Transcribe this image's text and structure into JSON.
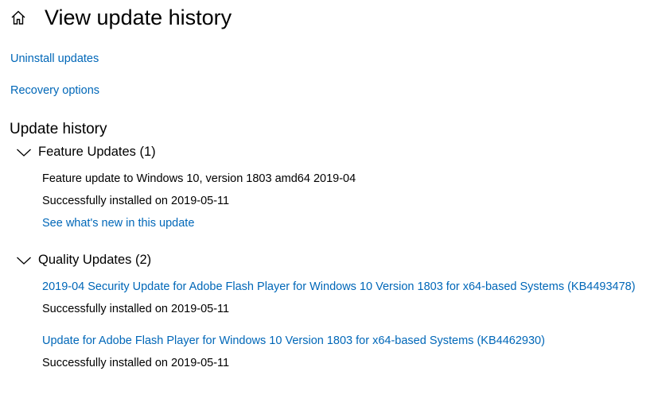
{
  "header": {
    "title": "View update history",
    "home_icon": "home-icon"
  },
  "nav": {
    "uninstall_updates": "Uninstall updates",
    "recovery_options": "Recovery options"
  },
  "history": {
    "heading": "Update history",
    "groups": [
      {
        "title": "Feature Updates (1)",
        "expanded": true,
        "items": [
          {
            "name": "Feature update to Windows 10, version 1803 amd64 2019-04",
            "status": "Successfully installed on 2019-05-11",
            "extra_link": "See what's new in this update"
          }
        ]
      },
      {
        "title": "Quality Updates (2)",
        "expanded": true,
        "items": [
          {
            "name": "2019-04 Security Update for Adobe Flash Player for Windows 10 Version 1803 for x64-based Systems (KB4493478)",
            "status": "Successfully installed on 2019-05-11"
          },
          {
            "name": "Update for Adobe Flash Player for Windows 10 Version 1803 for x64-based Systems (KB4462930)",
            "status": "Successfully installed on 2019-05-11"
          }
        ]
      }
    ]
  },
  "colors": {
    "link": "#0067b8",
    "text": "#000000",
    "background": "#ffffff"
  }
}
